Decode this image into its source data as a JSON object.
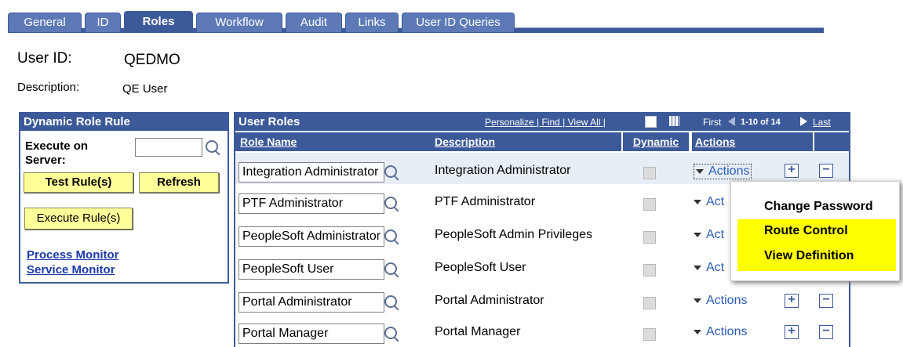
{
  "tabs": [
    "General",
    "ID",
    "Roles",
    "Workflow",
    "Audit",
    "Links",
    "User ID Queries"
  ],
  "active_tab": "Roles",
  "user": {
    "id_label": "User ID:",
    "id_value": "QEDMO",
    "desc_label": "Description:",
    "desc_value": "QE User"
  },
  "dynamic_rule": {
    "title": "Dynamic Role Rule",
    "execute_label": "Execute on Server:",
    "server_value": "",
    "test_button": "Test Rule(s)",
    "refresh_button": "Refresh",
    "execute_button": "Execute Rule(s)",
    "process_monitor": "Process Monitor",
    "service_monitor": "Service Monitor"
  },
  "grid": {
    "title": "User Roles",
    "toolbar": "Personalize | Find | View All |",
    "first": "First",
    "range": "1-10 of 14",
    "last": "Last",
    "columns": [
      "Role Name",
      "Description",
      "Dynamic",
      "Actions"
    ],
    "rows": [
      {
        "role": "Integration Administrator",
        "description": "Integration Administrator",
        "action": "Actions"
      },
      {
        "role": "PTF Administrator",
        "description": "PTF Administrator",
        "action": "Act"
      },
      {
        "role": "PeopleSoft Administrator",
        "description": "PeopleSoft Admin Privileges",
        "action": "Act"
      },
      {
        "role": "PeopleSoft User",
        "description": "PeopleSoft User",
        "action": "Act"
      },
      {
        "role": "Portal Administrator",
        "description": "Portal Administrator",
        "action": "Actions"
      },
      {
        "role": "Portal Manager",
        "description": "Portal Manager",
        "action": "Actions"
      }
    ]
  },
  "actions_menu": [
    "Change Password",
    "Route Control",
    "View Definition"
  ],
  "colors": {
    "header": "#3c5a9a",
    "tab": "#5d7ab7",
    "button": "#ffff99",
    "highlight": "#ffff00"
  }
}
